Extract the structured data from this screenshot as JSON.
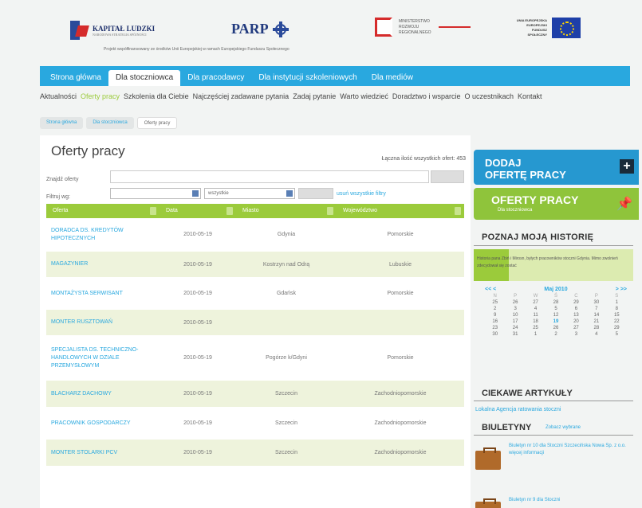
{
  "header": {
    "kapital_title": "KAPITAŁ LUDZKI",
    "kapital_sub": "NARODOWA STRATEGIA SPÓJNOŚCI",
    "parp": "PARP",
    "mrr_text": "MINISTERSTWO ROZWOJU REGIONALNEGO",
    "ue_text": "UNIA EUROPEJSKA EUROPEJSKI FUNDUSZ SPOŁECZNY",
    "cofund": "Projekt współfinansowany ze środków Unii Europejskiej w ramach Europejskiego Funduszu Społecznego"
  },
  "nav": {
    "tabs": [
      {
        "label": "Strona główna"
      },
      {
        "label": "Dla stoczniowca"
      },
      {
        "label": "Dla pracodawcy"
      },
      {
        "label": "Dla instytucji szkoleniowych"
      },
      {
        "label": "Dla mediów"
      }
    ],
    "active_index": 1
  },
  "subnav": [
    "Aktualności",
    "Oferty pracy",
    "Szkolenia dla Ciebie",
    "Najczęściej zadawane pytania",
    "Zadaj pytanie",
    "Warto wiedzieć",
    "Doradztwo i wsparcie",
    "O uczestnikach",
    "Kontakt"
  ],
  "breadcrumb": [
    "Strona główna",
    "Dla stoczniowca",
    "Oferty pracy"
  ],
  "main": {
    "title": "Oferty pracy",
    "total": "Łączna ilość wszystkich ofert: 453",
    "search_label": "Znajdź oferty",
    "filter_label": "Filtruj wg:",
    "select2": "wszystkie",
    "clear_filters": "usuń wszystkie filtry"
  },
  "table": {
    "columns": [
      "Oferta",
      "Data",
      "Miasto",
      "Województwo"
    ],
    "rows": [
      {
        "offer": "DORADCA DS. KREDYTÓW HIPOTECZNYCH",
        "date": "2010-05-19",
        "city": "Gdynia",
        "region": "Pomorskie"
      },
      {
        "offer": "MAGAZYNIER",
        "date": "2010-05-19",
        "city": "Kostrzyn nad Odrą",
        "region": "Lubuskie"
      },
      {
        "offer": "MONTAŻYSTA SERWISANT",
        "date": "2010-05-19",
        "city": "Gdańsk",
        "region": "Pomorskie"
      },
      {
        "offer": "MONTER RUSZTOWAŃ",
        "date": "2010-05-19",
        "city": "",
        "region": ""
      },
      {
        "offer": "SPECJALISTA DS. TECHNICZNO-HANDLOWYCH W DZIALE PRZEMYSŁOWYM",
        "date": "2010-05-19",
        "city": "Pogórze k/Gdyni",
        "region": "Pomorskie"
      },
      {
        "offer": "BLACHARZ DACHOWY",
        "date": "2010-05-19",
        "city": "Szczecin",
        "region": "Zachodniopomorskie"
      },
      {
        "offer": "PRACOWNIK GOSPODARCZY",
        "date": "2010-05-19",
        "city": "Szczecin",
        "region": "Zachodniopomorskie"
      },
      {
        "offer": "MONTER STOLARKI PCV",
        "date": "2010-05-19",
        "city": "Szczecin",
        "region": "Zachodniopomorskie"
      }
    ]
  },
  "sidebar": {
    "add_line1": "DODAJ",
    "add_line2": "OFERTĘ PRACY",
    "add_icon": "+",
    "jobs_line1": "OFERTY PRACY",
    "jobs_line2": "Dla stoczniowca",
    "story_title": "POZNAJ MOJĄ HISTORIĘ",
    "story_text": "Historia pana Zbiń i Mirosn, byłych pracowników stoczni Gdynia. Mimo zwolnień zdecydował się zostać",
    "calendar": {
      "prev": "<< <",
      "month": "Maj 2010",
      "next": "> >>",
      "days": [
        "N",
        "P",
        "W",
        "Ś",
        "C",
        "P",
        "S"
      ],
      "dates": [
        "25",
        "26",
        "27",
        "28",
        "29",
        "30",
        "1",
        "2",
        "3",
        "4",
        "5",
        "6",
        "7",
        "8",
        "9",
        "10",
        "11",
        "12",
        "13",
        "14",
        "15",
        "16",
        "17",
        "18",
        "19",
        "20",
        "21",
        "22",
        "23",
        "24",
        "25",
        "26",
        "27",
        "28",
        "29",
        "30",
        "31",
        "1",
        "2",
        "3",
        "4",
        "5"
      ],
      "today": "19"
    },
    "articles_title": "CIEKAWE ARTYKUŁY",
    "article_link": "Lokalna Agencja ratowania stoczni",
    "bulletins_title": "BIULETYNY",
    "bulletins_more": "Zobacz wybrane",
    "bulletins": [
      "Biuletyn nr 10 dla Stoczni Szczecińska Nowa Sp. z o.o. więcej informacji",
      "Biuletyn nr 9 dla Stoczni"
    ]
  }
}
